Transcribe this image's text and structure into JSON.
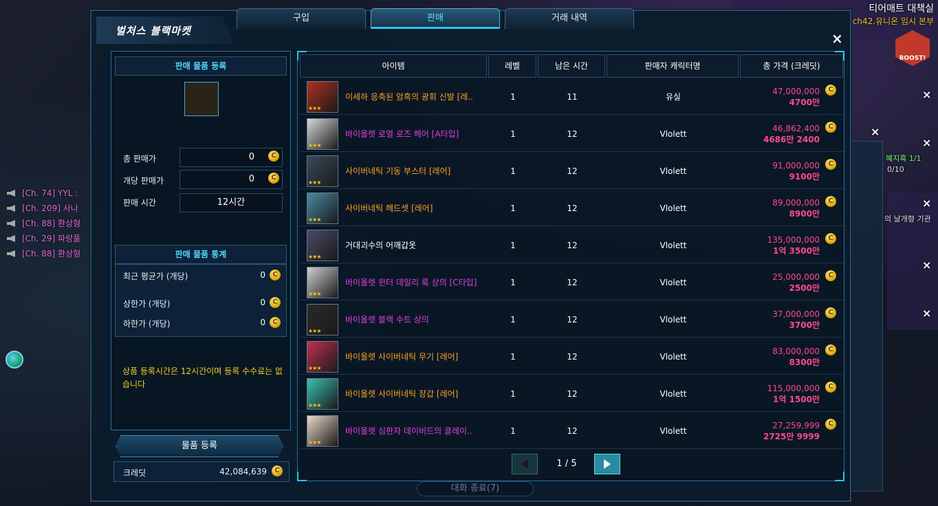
{
  "hud": {
    "title": "티어매트 대책실",
    "subtitle": "ch42.유니온 임시 본부",
    "boost_label": "BOOST!",
    "side_label_1": "혜지흑 1/1",
    "side_label_2": "0/10",
    "side_label_3": "의 날개형 기관"
  },
  "chat": [
    {
      "text": "[Ch. 74] YYL :"
    },
    {
      "text": "[Ch. 209] 사나"
    },
    {
      "text": "[Ch. 88] 환상형"
    },
    {
      "text": "[Ch. 29] 파랑풀"
    },
    {
      "text": "[Ch. 88] 환상형"
    }
  ],
  "window": {
    "title": "벌처스 블랙마켓",
    "tabs": [
      {
        "label": "구입"
      },
      {
        "label": "판매"
      },
      {
        "label": "거래 내역"
      }
    ],
    "close": "×"
  },
  "left": {
    "register_header": "판매 물품 등록",
    "total_price_label": "총 판매가",
    "total_price_value": "0",
    "unit_price_label": "개당 판매가",
    "unit_price_value": "0",
    "time_label": "판매 시간",
    "time_value": "12시간",
    "stats_header": "판매 물품 통계",
    "recent_avg_label": "최근 평균가 (개당)",
    "recent_avg_value": "0",
    "upper_label": "상한가 (개당)",
    "upper_value": "0",
    "lower_label": "하한가 (개당)",
    "lower_value": "0",
    "notice": "상품 등록시간은 12시간이며 등록 수수료는 없습니다",
    "register_button": "물품 등록",
    "credit_label": "크레딧",
    "credit_value": "42,084,639",
    "coin_glyph": "C"
  },
  "table": {
    "headers": {
      "item": "아이템",
      "level": "레벨",
      "time": "남은 시간",
      "seller": "판매자 캐릭터명",
      "price": "총 가격 (크레딧)"
    },
    "rows": [
      {
        "name": "이세하 응축된 암흑의 광휘 신발 [레..",
        "color": "#ffa020",
        "level": "1",
        "time": "11",
        "seller": "유실",
        "price": "47,000,000",
        "price_kr": "4700만",
        "icon_bg": "#b03020"
      },
      {
        "name": "바이올렛 로열 로즈 헤어 [A타입]",
        "color": "#e040e0",
        "level": "1",
        "time": "12",
        "seller": "Vlolett",
        "price": "46,862,400",
        "price_kr": "4686만 2400",
        "icon_bg": "#d8d8d8"
      },
      {
        "name": "사이버네틱 기동 부스터 [레어]",
        "color": "#ffa020",
        "level": "1",
        "time": "12",
        "seller": "Vlolett",
        "price": "91,000,000",
        "price_kr": "9100만",
        "icon_bg": "#3a4a5a"
      },
      {
        "name": "사이버네틱 헤드셋 [레어]",
        "color": "#ffa020",
        "level": "1",
        "time": "12",
        "seller": "Vlolett",
        "price": "89,000,000",
        "price_kr": "8900만",
        "icon_bg": "#4a8aa0"
      },
      {
        "name": "거대괴수의 어깨갑옷",
        "color": "#ffffff",
        "level": "1",
        "time": "12",
        "seller": "Vlolett",
        "price": "135,000,000",
        "price_kr": "1억 3500만",
        "icon_bg": "#4a4a6a"
      },
      {
        "name": "바이올렛 윈터 데일리 룩 상의 [C타입]",
        "color": "#e040e0",
        "level": "1",
        "time": "12",
        "seller": "Vlolett",
        "price": "25,000,000",
        "price_kr": "2500만",
        "icon_bg": "#d0d0d0"
      },
      {
        "name": "바이올렛 블랙 수트 상의",
        "color": "#e040e0",
        "level": "1",
        "time": "12",
        "seller": "Vlolett",
        "price": "37,000,000",
        "price_kr": "3700만",
        "icon_bg": "#2a2a2a"
      },
      {
        "name": "바이올렛 사이버네틱 무기 [레어]",
        "color": "#ffa020",
        "level": "1",
        "time": "12",
        "seller": "Vlolett",
        "price": "83,000,000",
        "price_kr": "8300만",
        "icon_bg": "#c03050"
      },
      {
        "name": "바이올렛 사이버네틱 장갑 [레어]",
        "color": "#ffa020",
        "level": "1",
        "time": "12",
        "seller": "Vlolett",
        "price": "115,000,000",
        "price_kr": "1억 1500만",
        "icon_bg": "#3ac0b0"
      },
      {
        "name": "바이올렛 심판자 데이비드의 클레이..",
        "color": "#e040e0",
        "level": "1",
        "time": "12",
        "seller": "Vlolett",
        "price": "27,259,999",
        "price_kr": "2725만 9999",
        "icon_bg": "#e8d8c8"
      }
    ],
    "stars": "★★★"
  },
  "pager": {
    "text": "1 / 5"
  },
  "bottom": {
    "text": "대화 종료(7)"
  }
}
